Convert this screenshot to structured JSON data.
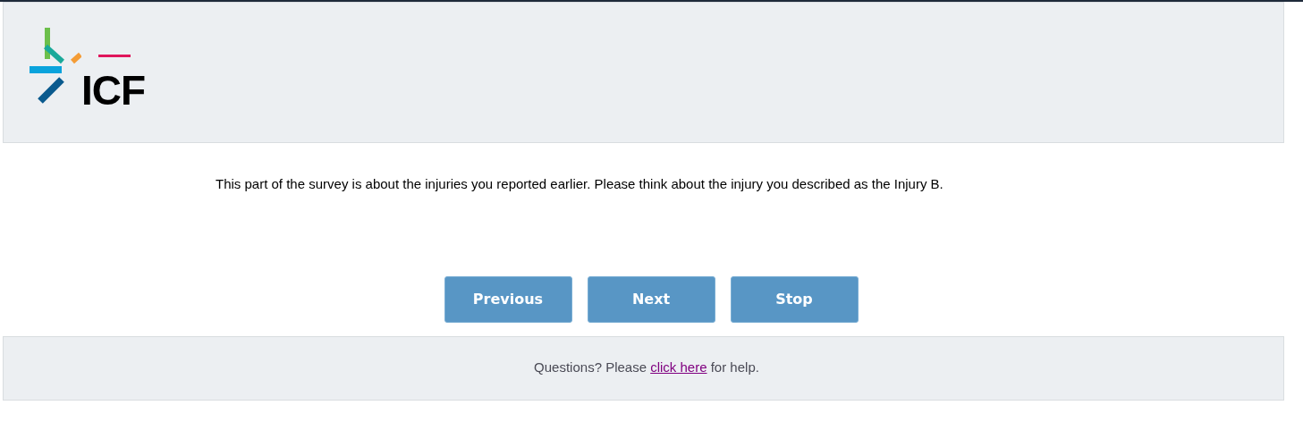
{
  "header": {
    "logo": {
      "text": "ICF"
    }
  },
  "intro": "This part of the survey is about the injuries you reported earlier. Please think about the injury you described as the Injury B.",
  "buttons": [
    {
      "label": "Previous"
    },
    {
      "label": "Next"
    },
    {
      "label": "Stop"
    }
  ],
  "footer": {
    "before": "Questions? Please ",
    "link": "click here",
    "after": " for help."
  }
}
